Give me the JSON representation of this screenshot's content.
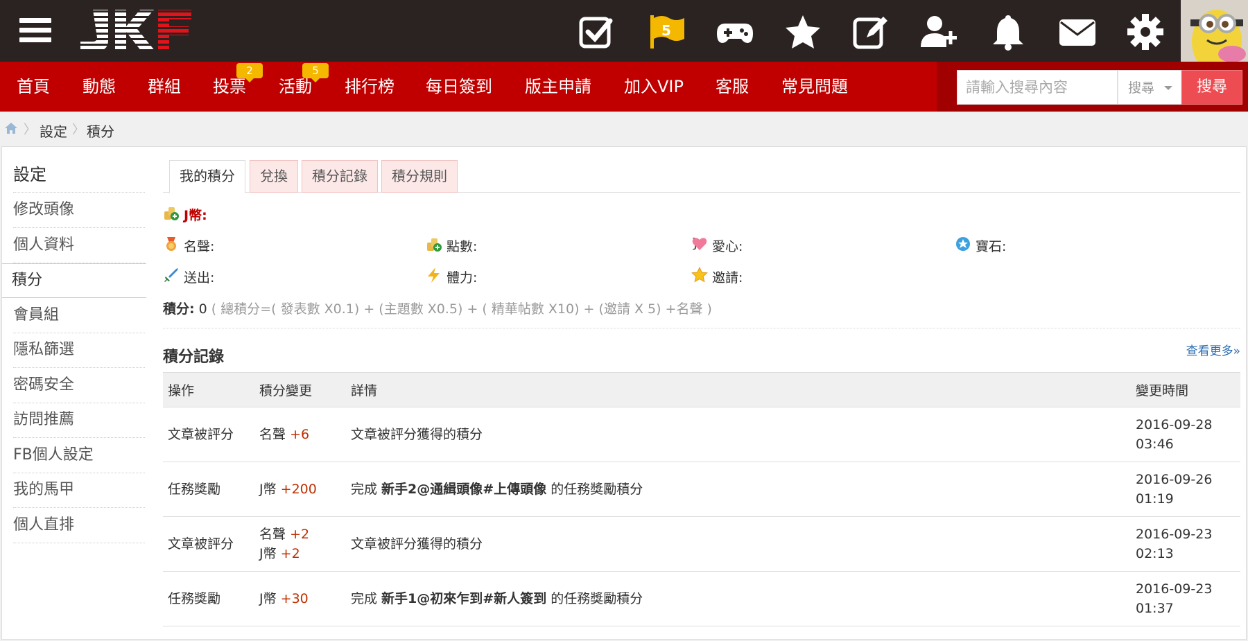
{
  "header": {
    "logo_text": "JKF",
    "flag_badge": "5",
    "icons": [
      "checkbox-icon",
      "flag-icon",
      "gamepad-icon",
      "star-icon",
      "edit-icon",
      "add-user-icon",
      "bell-icon",
      "mail-icon",
      "gear-icon"
    ]
  },
  "nav": {
    "items": [
      {
        "label": "首頁"
      },
      {
        "label": "動態"
      },
      {
        "label": "群組"
      },
      {
        "label": "投票",
        "badge": "2"
      },
      {
        "label": "活動",
        "badge": "5"
      },
      {
        "label": "排行榜"
      },
      {
        "label": "每日簽到"
      },
      {
        "label": "版主申請"
      },
      {
        "label": "加入VIP"
      },
      {
        "label": "客服"
      },
      {
        "label": "常見問題"
      }
    ],
    "search_placeholder": "請輸入搜尋內容",
    "search_select": "搜尋",
    "search_button": "搜尋"
  },
  "breadcrumb": [
    "設定",
    "積分"
  ],
  "sidebar": {
    "title": "設定",
    "items": [
      "修改頭像",
      "個人資料",
      "積分",
      "會員組",
      "隱私篩選",
      "密碼安全",
      "訪問推薦",
      "FB個人設定",
      "我的馬甲",
      "個人直排"
    ],
    "active_index": 2
  },
  "tabs": [
    "我的積分",
    "兌換",
    "積分記錄",
    "積分規則"
  ],
  "stats": {
    "jcoin": "J幣:",
    "row1": [
      "名聲:",
      "點數:",
      "愛心:",
      "寶石:"
    ],
    "row2": [
      "送出:",
      "體力:",
      "邀請:"
    ],
    "score_label": "積分:",
    "score_value": "0",
    "formula": "( 總積分=( 發表數 X0.1) + (主題數 X0.5) + ( 精華帖數 X10) + (邀請 X 5) +名聲 )"
  },
  "records": {
    "title": "積分記錄",
    "more": "查看更多»",
    "headers": [
      "操作",
      "積分變更",
      "詳情",
      "變更時間"
    ],
    "rows": [
      {
        "op": "文章被評分",
        "changes": [
          {
            "name": "名聲",
            "val": "+6"
          }
        ],
        "detail_pre": "文章被評分獲得的積分",
        "detail_bold": "",
        "detail_post": "",
        "date": "2016-09-28",
        "time": "03:46"
      },
      {
        "op": "任務獎勵",
        "changes": [
          {
            "name": "J幣",
            "val": "+200"
          }
        ],
        "detail_pre": "完成 ",
        "detail_bold": "新手2@通緝頭像#上傳頭像",
        "detail_post": " 的任務獎勵積分",
        "date": "2016-09-26",
        "time": "01:19"
      },
      {
        "op": "文章被評分",
        "changes": [
          {
            "name": "名聲",
            "val": "+2"
          },
          {
            "name": "J幣",
            "val": "+2"
          }
        ],
        "detail_pre": "文章被評分獲得的積分",
        "detail_bold": "",
        "detail_post": "",
        "date": "2016-09-23",
        "time": "02:13"
      },
      {
        "op": "任務獎勵",
        "changes": [
          {
            "name": "J幣",
            "val": "+30"
          }
        ],
        "detail_pre": "完成 ",
        "detail_bold": "新手1@初來乍到#新人簽到",
        "detail_post": " 的任務獎勵積分",
        "date": "2016-09-23",
        "time": "01:37"
      }
    ]
  },
  "colors": {
    "topbar": "#2a2321",
    "nav_red": "#c00000",
    "badge_yellow": "#f5b800",
    "search_button": "#ec4c52",
    "positive_change": "#c03000"
  }
}
